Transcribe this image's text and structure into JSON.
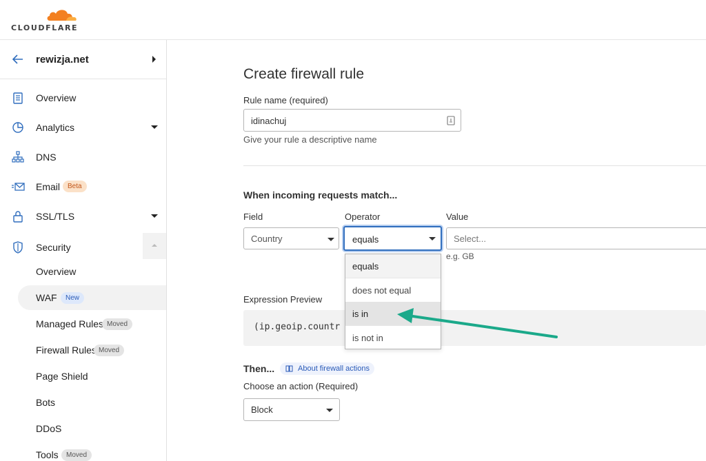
{
  "brand": {
    "logo_text": "CLOUDFLARE",
    "accent": "#f38020"
  },
  "sidebar": {
    "zone": "rewizja.net",
    "items": [
      {
        "label": "Overview",
        "icon": "clipboard-icon"
      },
      {
        "label": "Analytics",
        "icon": "pie-chart-icon"
      },
      {
        "label": "DNS",
        "icon": "network-icon"
      },
      {
        "label": "Email",
        "icon": "email-icon",
        "badge": "Beta"
      },
      {
        "label": "SSL/TLS",
        "icon": "lock-icon"
      },
      {
        "label": "Security",
        "icon": "shield-icon"
      }
    ],
    "security_sub": [
      {
        "label": "Overview"
      },
      {
        "label": "WAF",
        "badge": "New"
      },
      {
        "label": "Managed Rules",
        "badge": "Moved"
      },
      {
        "label": "Firewall Rules",
        "badge": "Moved"
      },
      {
        "label": "Page Shield"
      },
      {
        "label": "Bots"
      },
      {
        "label": "DDoS"
      },
      {
        "label": "Tools",
        "badge": "Moved"
      }
    ]
  },
  "main": {
    "title": "Create firewall rule",
    "rule_name": {
      "label": "Rule name (required)",
      "value": "idinachuj",
      "help": "Give your rule a descriptive name"
    },
    "match": {
      "heading": "When incoming requests match...",
      "field_label": "Field",
      "field_value": "Country",
      "operator_label": "Operator",
      "operator_value": "equals",
      "value_label": "Value",
      "value_placeholder": "Select...",
      "value_help": "e.g. GB"
    },
    "operator_options": [
      "equals",
      "does not equal",
      "is in",
      "is not in"
    ],
    "highlighted_option": "is in",
    "expression": {
      "label": "Expression Preview",
      "code": "(ip.geoip.countr"
    },
    "then": {
      "heading": "Then...",
      "about_link": "About firewall actions",
      "action_label": "Choose an action (Required)",
      "action_value": "Block"
    },
    "annotation_arrow_color": "#1ba98a"
  }
}
